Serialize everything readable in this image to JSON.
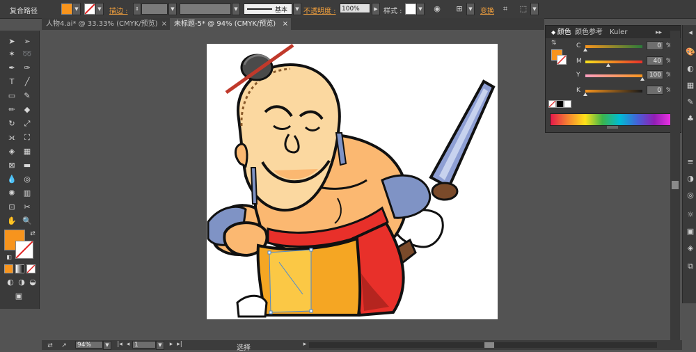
{
  "control_bar": {
    "selection_type": "复合路径",
    "stroke_link": "描边 :",
    "stroke_profile": "基本",
    "opacity_label": "不透明度 :",
    "opacity_value": "100%",
    "style_label": "样式 :",
    "transform_link": "变换",
    "fill_color": "#f7941d"
  },
  "tabs": [
    {
      "label": "人物4.ai* @ 33.33% (CMYK/预览)",
      "close": "×"
    },
    {
      "label": "未标题-5* @ 94% (CMYK/预览)",
      "close": "×"
    }
  ],
  "color_panel": {
    "tabs": [
      "颜色",
      "颜色参考",
      "Kuler"
    ],
    "sliders": [
      {
        "label": "C",
        "value": "0",
        "pct": "%",
        "position": 0.0
      },
      {
        "label": "M",
        "value": "40",
        "pct": "%",
        "position": 0.4
      },
      {
        "label": "Y",
        "value": "100",
        "pct": "%",
        "position": 1.0
      },
      {
        "label": "K",
        "value": "0",
        "pct": "%",
        "position": 0.0
      }
    ],
    "fill_color": "#f7941d"
  },
  "toolbox": {
    "fill_color": "#f7941d"
  },
  "status_bar": {
    "zoom": "94%",
    "page": "1",
    "tool_name": "选择"
  }
}
